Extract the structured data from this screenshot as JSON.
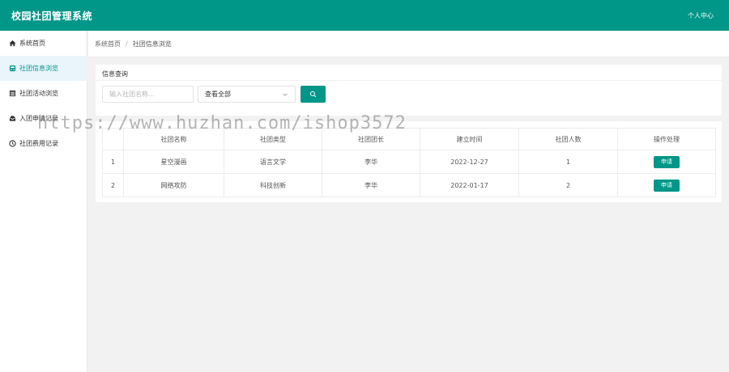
{
  "app": {
    "title": "校园社团管理系统",
    "user_center": "个人中心"
  },
  "sidebar": {
    "items": [
      {
        "label": "系统首页",
        "icon": "home-icon"
      },
      {
        "label": "社团信息浏览",
        "icon": "group-icon",
        "active": true
      },
      {
        "label": "社团活动浏览",
        "icon": "calendar-icon"
      },
      {
        "label": "入团申请记录",
        "icon": "inbox-icon"
      },
      {
        "label": "社团费用记录",
        "icon": "clock-icon"
      }
    ]
  },
  "breadcrumb": {
    "home": "系统首页",
    "separator": "/",
    "current": "社团信息浏览"
  },
  "search": {
    "title": "信息查询",
    "placeholder": "输入社团名称...",
    "select_value": "查看全部"
  },
  "table": {
    "headers": [
      "",
      "社团名称",
      "社团类型",
      "社团团长",
      "建立时间",
      "社团人数",
      "操作处理"
    ],
    "rows": [
      {
        "index": "1",
        "name": "星空漫画",
        "type": "语言文学",
        "leader": "李华",
        "founded": "2022-12-27",
        "members": "1",
        "action": "申请"
      },
      {
        "index": "2",
        "name": "网络攻防",
        "type": "科技创新",
        "leader": "李华",
        "founded": "2022-01-17",
        "members": "2",
        "action": "申请"
      }
    ]
  },
  "watermark": "https://www.huzhan.com/ishop3572",
  "colors": {
    "accent": "#009688",
    "background": "#f2f2f2"
  }
}
